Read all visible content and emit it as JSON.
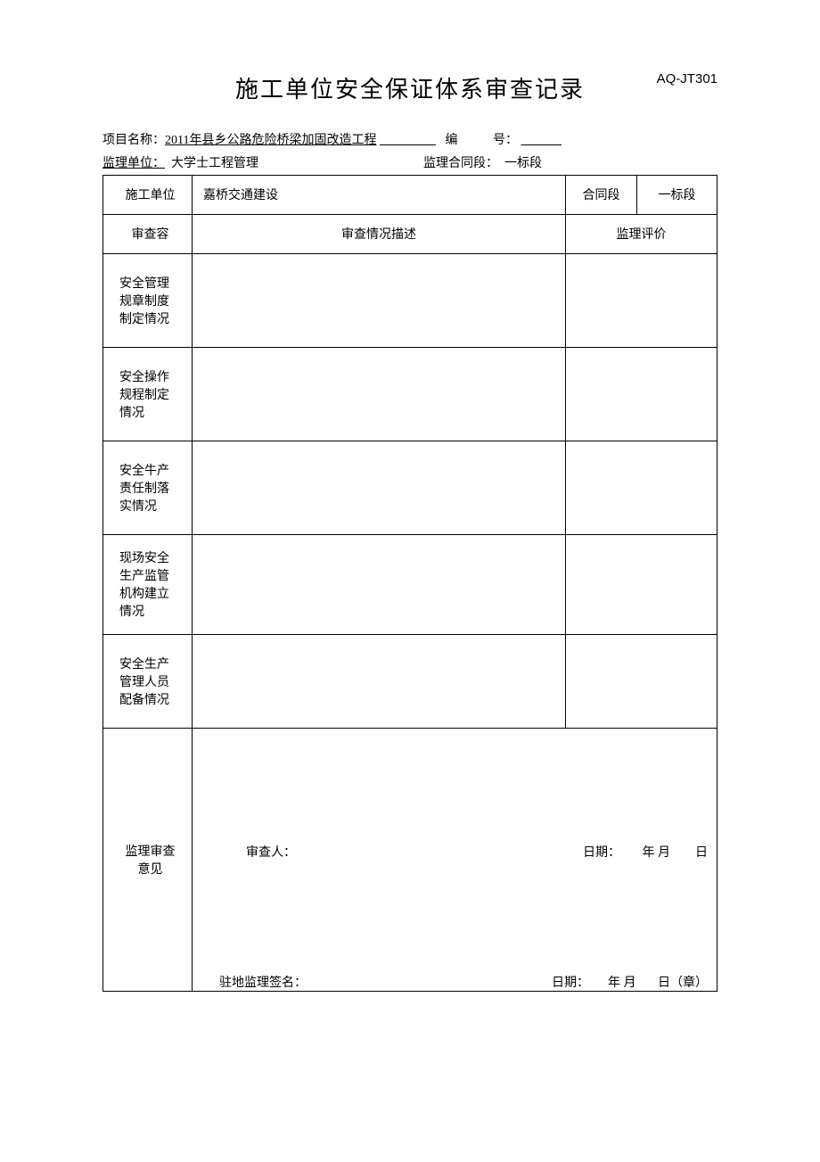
{
  "header": {
    "title": "施工单位安全保证体系审查记录",
    "doc_code": "AQ-JT301"
  },
  "meta": {
    "project_label": "项目名称：",
    "project_value": "2011年县乡公路危险桥梁加固改造工程",
    "number_label_1": "编",
    "number_label_2": "号：",
    "supervisor_label": "监理单位：",
    "supervisor_value": "大学士工程管理",
    "contract_section_label": "监理合同段：",
    "contract_section_value": "一标段"
  },
  "table": {
    "r1": {
      "c1": "施工单位",
      "c2": "嘉桥交通建设",
      "c3": "合同段",
      "c4": "一标段"
    },
    "r2": {
      "c1": "审查容",
      "c2": "审查情况描述",
      "c34": "监理评价"
    },
    "r3": {
      "c1": "安全管理规章制度制定情况"
    },
    "r4": {
      "c1": "安全操作规程制定情况"
    },
    "r5": {
      "c1": "安全牛产责任制落实情况"
    },
    "r6": {
      "c1": "现场安全生产监管机构建立情况"
    },
    "r7": {
      "c1": "安全生产管理人员配备情况"
    },
    "r8": {
      "c1": "监理审查 意见",
      "reviewer_label": "审查人：",
      "date1_label": "日期：",
      "date1_ym": "年 月",
      "date1_d": "日",
      "signer_label": "驻地监理签名：",
      "date2_label": "日期：",
      "date2_ym": "年 月",
      "date2_d": "日（章）"
    }
  }
}
